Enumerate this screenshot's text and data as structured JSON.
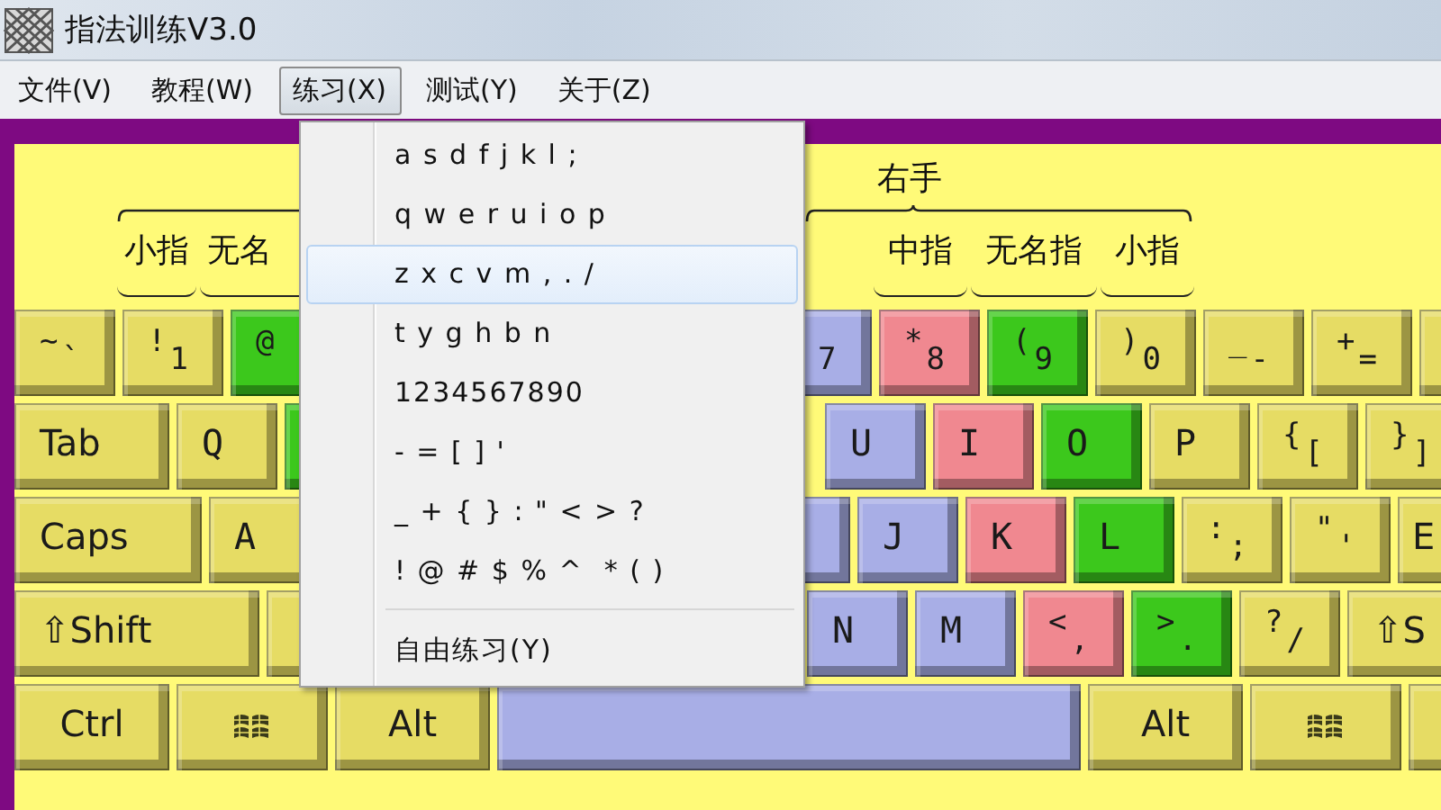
{
  "window": {
    "title": "指法训练V3.0"
  },
  "menu_bar": [
    {
      "label": "文件(V)",
      "selected": false
    },
    {
      "label": "教程(W)",
      "selected": false
    },
    {
      "label": "练习(X)",
      "selected": true
    },
    {
      "label": "测试(Y)",
      "selected": false
    },
    {
      "label": "关于(Z)",
      "selected": false
    }
  ],
  "dropdown": {
    "items": [
      {
        "label": "a s d f j k l ;",
        "selected": false
      },
      {
        "label": "q w e r u i o p",
        "selected": false
      },
      {
        "label": "z x c v m , . /",
        "selected": true
      },
      {
        "label": "t y g h b n",
        "selected": false
      },
      {
        "label": "1234567890",
        "selected": false
      },
      {
        "label": "- = [ ] '",
        "selected": false
      },
      {
        "label": "_ + { } : \" < > ?",
        "selected": false
      },
      {
        "label": "! @ # $ % ^  * ( )",
        "selected": false
      }
    ],
    "extra_items": [
      {
        "label": "自由练习(Y)",
        "selected": false
      }
    ]
  },
  "hands": {
    "left": {
      "fingers": [
        "小指",
        "无名"
      ]
    },
    "right": {
      "label": "右手",
      "fingers": [
        "中指",
        "无名指",
        "小指"
      ]
    }
  },
  "keyboard": {
    "rows": [
      [
        {
          "kind": "normal",
          "shift": "~",
          "base": "`",
          "color": "#e6dc64"
        },
        {
          "kind": "normal",
          "shift": "!",
          "base": "1",
          "color": "#e6dc64"
        },
        {
          "kind": "normal",
          "shift": "@",
          "color": "#3cc81c"
        },
        {
          "kind": "normal",
          "base": "7",
          "color": "#a8aee6"
        },
        {
          "kind": "normal",
          "shift": "*",
          "base": "8",
          "color": "#f08890"
        },
        {
          "kind": "normal",
          "shift": "(",
          "base": "9",
          "color": "#3cc81c"
        },
        {
          "kind": "normal",
          "shift": ")",
          "base": "0",
          "color": "#e6dc64"
        },
        {
          "kind": "normal",
          "shift": "_",
          "base": "-",
          "color": "#e6dc64"
        },
        {
          "kind": "normal",
          "shift": "+",
          "base": "=",
          "color": "#e6dc64"
        },
        {
          "kind": "normal",
          "color": "#e6dc64"
        }
      ],
      [
        {
          "kind": "tab",
          "label": "Tab",
          "color": "#e6dc64"
        },
        {
          "kind": "normal",
          "label": "Q",
          "color": "#e6dc64"
        },
        {
          "kind": "normal",
          "color": "#3cc81c"
        },
        {
          "kind": "normal",
          "label": "U",
          "color": "#a8aee6"
        },
        {
          "kind": "normal",
          "label": "I",
          "color": "#f08890"
        },
        {
          "kind": "normal",
          "label": "O",
          "color": "#3cc81c"
        },
        {
          "kind": "normal",
          "label": "P",
          "color": "#e6dc64"
        },
        {
          "kind": "normal",
          "shift": "{",
          "base": "[",
          "color": "#e6dc64"
        },
        {
          "kind": "normal",
          "shift": "}",
          "base": "]",
          "color": "#e6dc64"
        }
      ],
      [
        {
          "kind": "caps",
          "label": "Caps",
          "color": "#e6dc64"
        },
        {
          "kind": "normal",
          "label": "A",
          "color": "#e6dc64"
        },
        {
          "kind": "normal",
          "color": "#a8aee6"
        },
        {
          "kind": "normal",
          "label": "J",
          "color": "#a8aee6"
        },
        {
          "kind": "normal",
          "label": "K",
          "color": "#f08890"
        },
        {
          "kind": "normal",
          "label": "L",
          "color": "#3cc81c"
        },
        {
          "kind": "normal",
          "shift": ":",
          "base": ";",
          "color": "#e6dc64"
        },
        {
          "kind": "normal",
          "shift": "\"",
          "base": "'",
          "color": "#e6dc64"
        },
        {
          "kind": "enter",
          "label": "E",
          "color": "#e6dc64"
        }
      ],
      [
        {
          "kind": "shift",
          "label": "⇧Shift",
          "color": "#e6dc64"
        },
        {
          "kind": "normal",
          "color": "#e6dc64"
        },
        {
          "kind": "normal",
          "label": "N",
          "color": "#a8aee6"
        },
        {
          "kind": "normal",
          "label": "M",
          "color": "#a8aee6"
        },
        {
          "kind": "normal",
          "shift": "<",
          "base": ",",
          "color": "#f08890"
        },
        {
          "kind": "normal",
          "shift": ">",
          "base": ".",
          "color": "#3cc81c"
        },
        {
          "kind": "normal",
          "shift": "?",
          "base": "/",
          "color": "#e6dc64"
        },
        {
          "kind": "shift",
          "label": "⇧S",
          "color": "#e6dc64"
        }
      ],
      [
        {
          "kind": "ctrl",
          "label": "Ctrl",
          "color": "#e6dc64"
        },
        {
          "kind": "win",
          "color": "#e6dc64"
        },
        {
          "kind": "alt",
          "label": "Alt",
          "color": "#e6dc64"
        },
        {
          "kind": "space",
          "color": "#a8aee6"
        },
        {
          "kind": "alt",
          "label": "Alt",
          "color": "#e6dc64"
        },
        {
          "kind": "win",
          "color": "#e6dc64"
        },
        {
          "kind": "normal",
          "color": "#e6dc64"
        }
      ]
    ]
  }
}
